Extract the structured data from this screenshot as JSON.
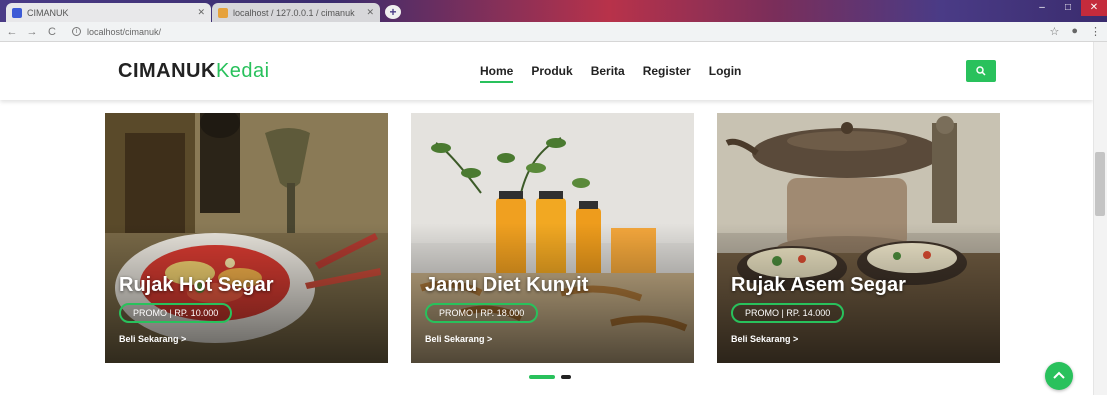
{
  "browser": {
    "tabs": [
      {
        "title": "CIMANUK",
        "favicon_color": "#3d5bd6"
      },
      {
        "title": "localhost / 127.0.0.1 / cimanuk",
        "favicon_color": "#e6a23c"
      }
    ],
    "new_tab_label": "+",
    "url": "localhost/cimanuk/",
    "back_icon": "←",
    "forward_icon": "→",
    "reload_icon": "C",
    "star_icon": "☆",
    "profile_icon": "●",
    "menu_icon": "⋮"
  },
  "site": {
    "brand_part1": "CIMANUK",
    "brand_part2": "Kedai",
    "accent_color": "#29c15c",
    "nav": [
      {
        "label": "Home",
        "active": true
      },
      {
        "label": "Produk",
        "active": false
      },
      {
        "label": "Berita",
        "active": false
      },
      {
        "label": "Register",
        "active": false
      },
      {
        "label": "Login",
        "active": false
      }
    ]
  },
  "cards": [
    {
      "title": "Rujak Hot Segar",
      "promo": "PROMO | RP. 10.000",
      "buy_label": "Beli Sekarang >"
    },
    {
      "title": "Jamu Diet Kunyit",
      "promo": "PROMO | RP. 18.000",
      "buy_label": "Beli Sekarang >"
    },
    {
      "title": "Rujak Asem Segar",
      "promo": "PROMO | RP. 14.000",
      "buy_label": "Beli Sekarang >"
    }
  ],
  "carousel": {
    "active_index": 0,
    "total": 2
  }
}
